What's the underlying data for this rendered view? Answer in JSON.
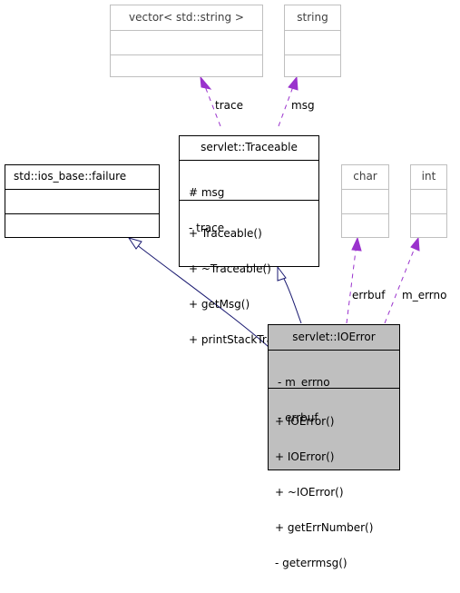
{
  "diagram": {
    "type": "uml-class-collaboration",
    "classes": {
      "vector": {
        "name": "vector< std::string >",
        "attributes": [],
        "methods": []
      },
      "string": {
        "name": "string",
        "attributes": [],
        "methods": []
      },
      "failure": {
        "name": "std::ios_base::failure",
        "attributes": [],
        "methods": []
      },
      "traceable": {
        "name": "servlet::Traceable",
        "attributes": [
          "# msg",
          "- trace"
        ],
        "methods": [
          "+ Traceable()",
          "+ ~Traceable()",
          "+ getMsg()",
          "+ printStackTrace()"
        ]
      },
      "char": {
        "name": "char",
        "attributes": [],
        "methods": []
      },
      "int": {
        "name": "int",
        "attributes": [],
        "methods": []
      },
      "ioerror": {
        "name": "servlet::IOError",
        "attributes": [
          "- m_errno",
          "- errbuf"
        ],
        "methods": [
          "+ IOError()",
          "+ IOError()",
          "+ ~IOError()",
          "+ getErrNumber()",
          "- geterrmsg()"
        ]
      }
    },
    "edges": [
      {
        "from": "traceable",
        "to": "vector",
        "kind": "usage",
        "label": "trace"
      },
      {
        "from": "traceable",
        "to": "string",
        "kind": "usage",
        "label": "msg"
      },
      {
        "from": "ioerror",
        "to": "failure",
        "kind": "inheritance",
        "label": ""
      },
      {
        "from": "ioerror",
        "to": "traceable",
        "kind": "inheritance",
        "label": ""
      },
      {
        "from": "ioerror",
        "to": "char",
        "kind": "usage",
        "label": "errbuf"
      },
      {
        "from": "ioerror",
        "to": "int",
        "kind": "usage",
        "label": "m_errno"
      }
    ],
    "colors": {
      "inheritance": "#191970",
      "usage": "#9a32cd",
      "focus_fill": "#bfbfbf",
      "external_border": "#bfbfbf"
    }
  }
}
